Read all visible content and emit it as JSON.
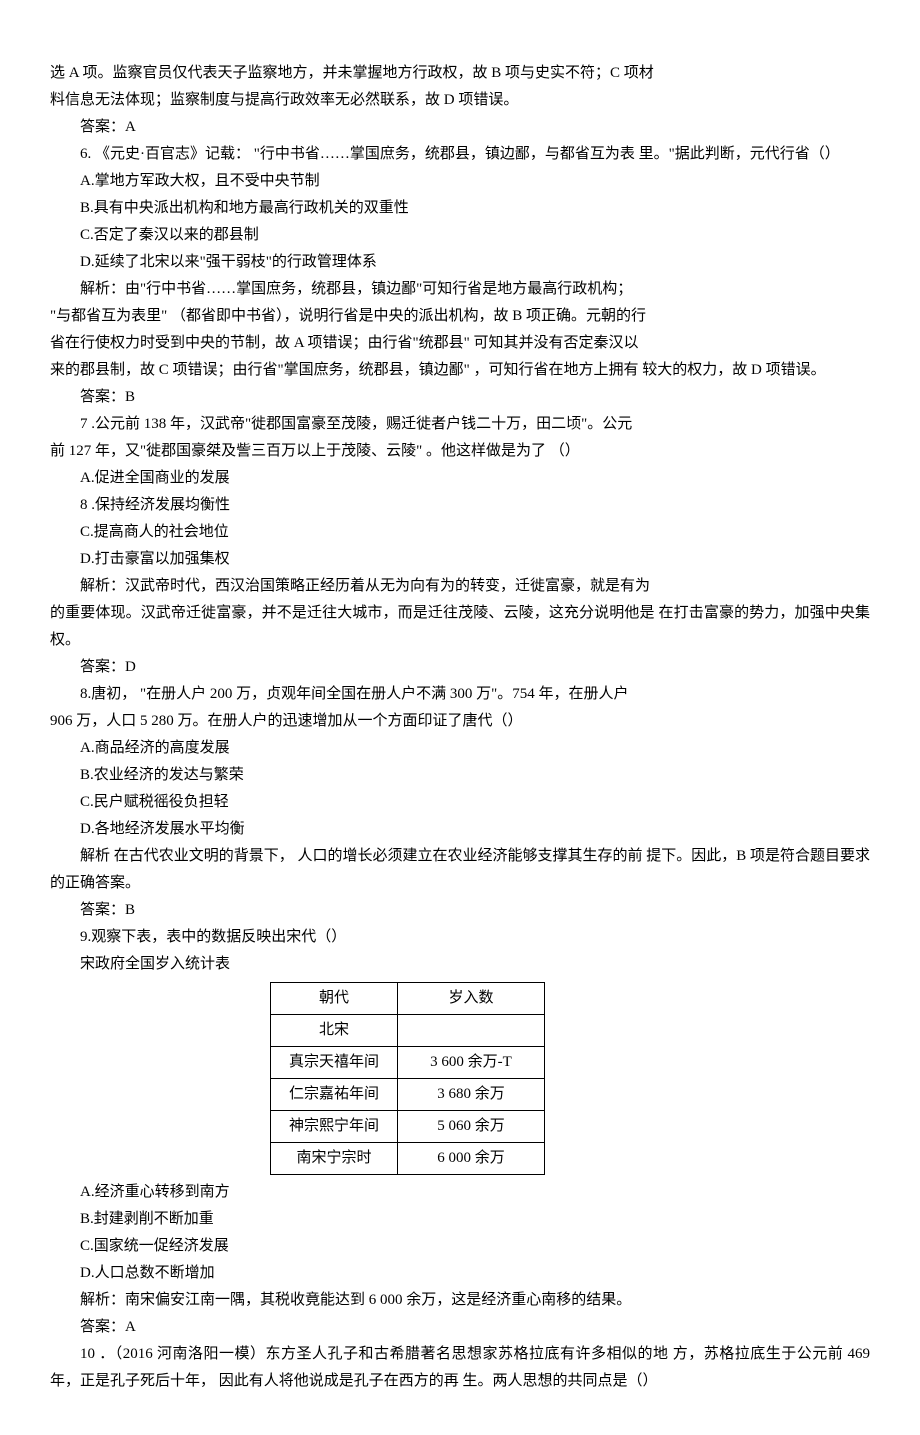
{
  "intro_lines": [
    "选 A 项。监察官员仅代表天子监察地方，并未掌握地方行政权，故 B 项与史实不符；C 项材",
    "料信息无法体现；监察制度与提高行政效率无必然联系，故 D 项错误。"
  ],
  "intro_answer": "答案：A",
  "q6": {
    "stem1": "6. 《元史·百官志》记载： \"行中书省……掌国庶务，统郡县，镇边鄙，与都省互为表 里。\"据此判断，元代行省（）",
    "optA": "A.掌地方军政大权，且不受中央节制",
    "optB": "B.具有中央派出机构和地方最高行政机关的双重性",
    "optC": "C.否定了秦汉以来的郡县制",
    "optD": "D.延续了北宋以来\"强干弱枝\"的行政管理体系",
    "ana1": "解析：由\"行中书省……掌国庶务，统郡县，镇边鄙\"可知行省是地方最高行政机构；",
    "ana2": "\"与都省互为表里\" （都省即中书省），说明行省是中央的派出机构，故 B 项正确。元朝的行",
    "ana3": "省在行使权力时受到中央的节制，故 A 项错误；由行省\"统郡县\" 可知其并没有否定秦汉以",
    "ana4": "来的郡县制，故 C 项错误；由行省\"掌国庶务，统郡县，镇边鄙\" ，可知行省在地方上拥有 较大的权力，故 D 项错误。",
    "answer": "答案：B"
  },
  "q7": {
    "stem1": "7 .公元前 138 年，汉武帝\"徙郡国富豪至茂陵，赐迁徙者户钱二十万，田二顷\"。公元",
    "stem2": "前 127 年，又\"徙郡国豪桀及訾三百万以上于茂陵、云陵\" 。他这样做是为了  （）",
    "optA": "A.促进全国商业的发展",
    "optB": "8 .保持经济发展均衡性",
    "optC": "C.提高商人的社会地位",
    "optD": "D.打击豪富以加强集权",
    "ana1": "解析：汉武帝时代，西汉治国策略正经历着从无为向有为的转变，迁徙富豪，就是有为",
    "ana2": "的重要体现。汉武帝迁徙富豪，并不是迁往大城市，而是迁往茂陵、云陵，这充分说明他是 在打击富豪的势力，加强中央集权。",
    "answer": "答案：D"
  },
  "q8": {
    "stem1": "8.唐初， \"在册人户 200 万，贞观年间全国在册人户不满 300 万\"。754 年，在册人户",
    "stem2": "906 万，人口  5 280 万。在册人户的迅速增加从一个方面印证了唐代（）",
    "optA": "A.商品经济的高度发展",
    "optB": "B.农业经济的发达与繁荣",
    "optC": "C.民户赋税徭役负担轻",
    "optD": "D.各地经济发展水平均衡",
    "ana": "解析 在古代农业文明的背景下，  人口的增长必须建立在农业经济能够支撑其生存的前 提下。因此，B 项是符合题目要求的正确答案。",
    "answer": "答案：B"
  },
  "q9": {
    "stem": "9.观察下表，表中的数据反映出宋代（）",
    "caption": "宋政府全国岁入统计表",
    "optA": "A.经济重心转移到南方",
    "optB": "B.封建剥削不断加重",
    "optC": "C.国家统一促经济发展",
    "optD": "D.人口总数不断增加",
    "ana": "解析：南宋偏安江南一隅，其税收竟能达到 6 000 余万，这是经济重心南移的结果。",
    "answer": "答案：A"
  },
  "q10": {
    "stem": "10 ．（2016 河南洛阳一模）东方圣人孔子和古希腊著名思想家苏格拉底有许多相似的地 方，苏格拉底生于公元前 469 年，正是孔子死后十年， 因此有人将他说成是孔子在西方的再 生。两人思想的共同点是（）"
  },
  "chart_data": {
    "type": "table",
    "title": "宋政府全国岁入统计表",
    "columns": [
      "朝代",
      "岁入数"
    ],
    "rows": [
      [
        "北宋",
        ""
      ],
      [
        "真宗天禧年间",
        "3 600 余万-T"
      ],
      [
        "仁宗嘉祐年间",
        "3 680 余万"
      ],
      [
        "神宗熙宁年间",
        "5 060 余万"
      ],
      [
        "南宋宁宗时",
        "6 000 余万"
      ]
    ]
  }
}
